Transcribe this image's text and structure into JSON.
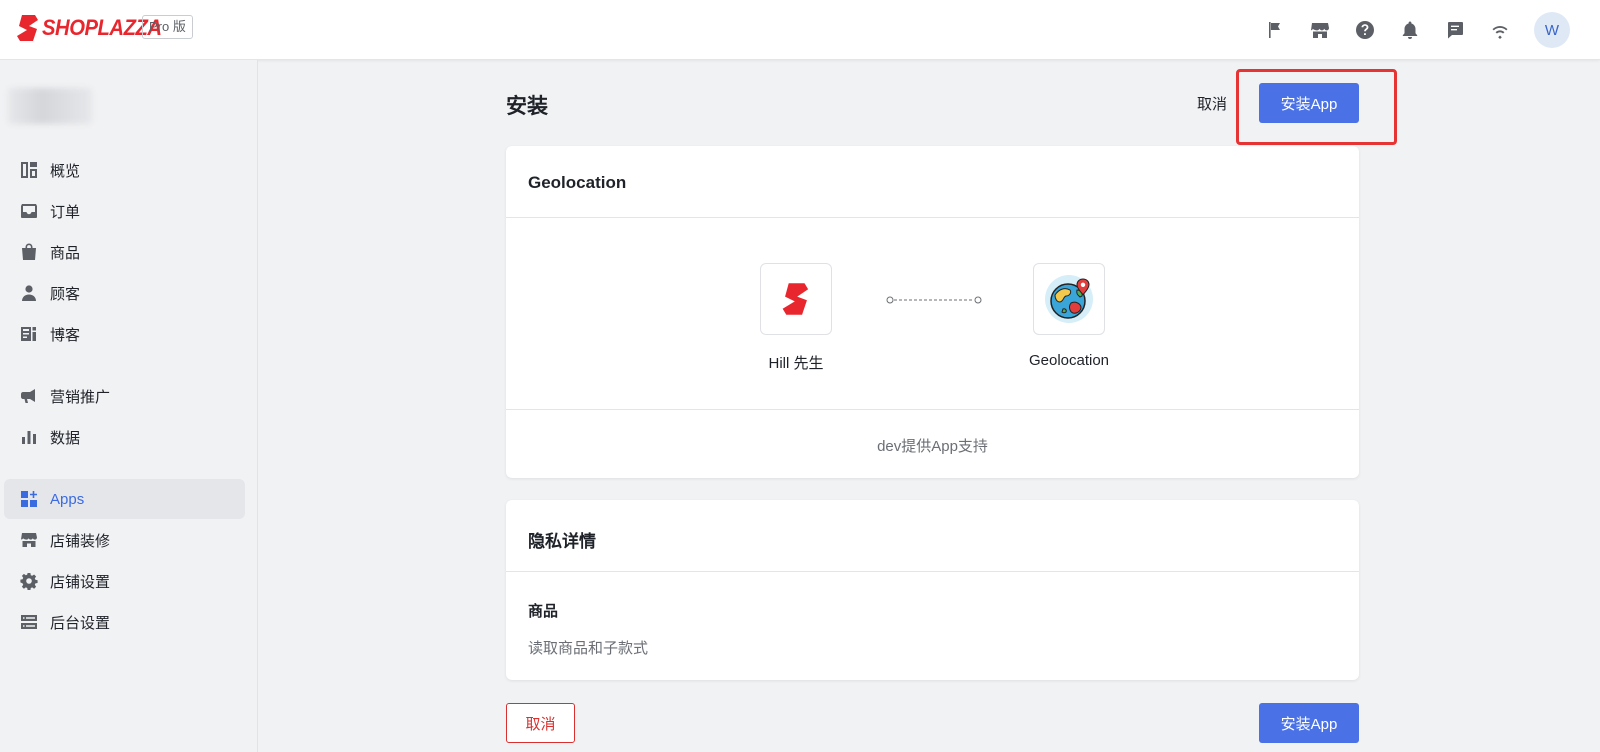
{
  "header": {
    "brand": "SHOPLAZZA",
    "edition": "Pro 版",
    "avatar_initial": "W",
    "icons": [
      "flag-icon",
      "store-icon",
      "help-icon",
      "bell-icon",
      "chat-icon",
      "wifi-icon"
    ]
  },
  "sidebar": {
    "items": [
      {
        "label": "概览",
        "icon": "dashboard-icon"
      },
      {
        "label": "订单",
        "icon": "inbox-icon"
      },
      {
        "label": "商品",
        "icon": "bag-icon"
      },
      {
        "label": "顾客",
        "icon": "person-icon"
      },
      {
        "label": "博客",
        "icon": "blog-icon"
      },
      {
        "label": "营销推广",
        "icon": "megaphone-icon"
      },
      {
        "label": "数据",
        "icon": "bar-chart-icon"
      },
      {
        "label": "Apps",
        "icon": "apps-icon",
        "active": true
      },
      {
        "label": "店铺装修",
        "icon": "storefront-icon"
      },
      {
        "label": "店铺设置",
        "icon": "gear-icon"
      },
      {
        "label": "后台设置",
        "icon": "server-icon"
      }
    ]
  },
  "main": {
    "title": "安装",
    "cancel_label": "取消",
    "install_label": "安装App",
    "app_card": {
      "title": "Geolocation",
      "store_name": "Hill 先生",
      "app_name": "Geolocation",
      "support_text": "dev提供App支持"
    },
    "privacy_card": {
      "title": "隐私详情",
      "permission_title": "商品",
      "permission_desc": "读取商品和子款式"
    },
    "bottom_cancel_label": "取消",
    "bottom_install_label": "安装App"
  },
  "colors": {
    "brand": "#e8262e",
    "primary": "#4a72e6",
    "danger": "#d9302f",
    "highlight": "#e63434"
  }
}
